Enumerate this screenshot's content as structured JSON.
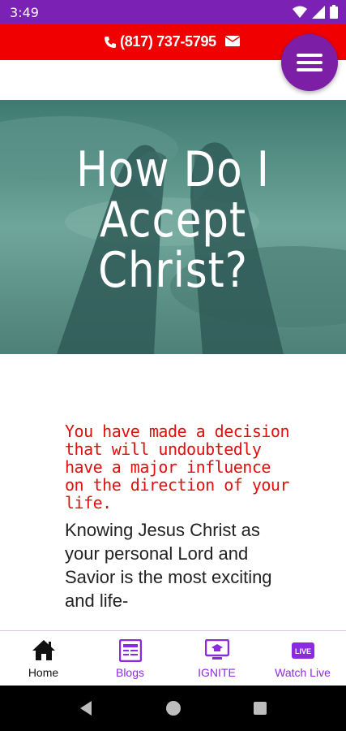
{
  "status_bar": {
    "time": "3:49"
  },
  "contact": {
    "phone": "(817) 737-5795"
  },
  "hero": {
    "title_lines": [
      "How Do I",
      "Accept",
      "Christ?"
    ]
  },
  "content": {
    "lead": "You have made a decision that will undoubtedly have a major influence on the direction of your life.",
    "body": "Knowing Jesus Christ as your personal Lord and Savior is the most exciting and life-"
  },
  "bottom_nav": {
    "items": [
      {
        "label": "Home",
        "icon": "home-icon",
        "active": true
      },
      {
        "label": "Blogs",
        "icon": "blogs-icon",
        "active": false
      },
      {
        "label": "IGNITE",
        "icon": "ignite-icon",
        "active": false
      },
      {
        "label": "Watch Live",
        "icon": "live-icon",
        "active": false
      }
    ]
  },
  "colors": {
    "status": "#7b22b5",
    "contact_bar": "#f00000",
    "accent": "#8a2be2",
    "lead_text": "#e01010"
  }
}
